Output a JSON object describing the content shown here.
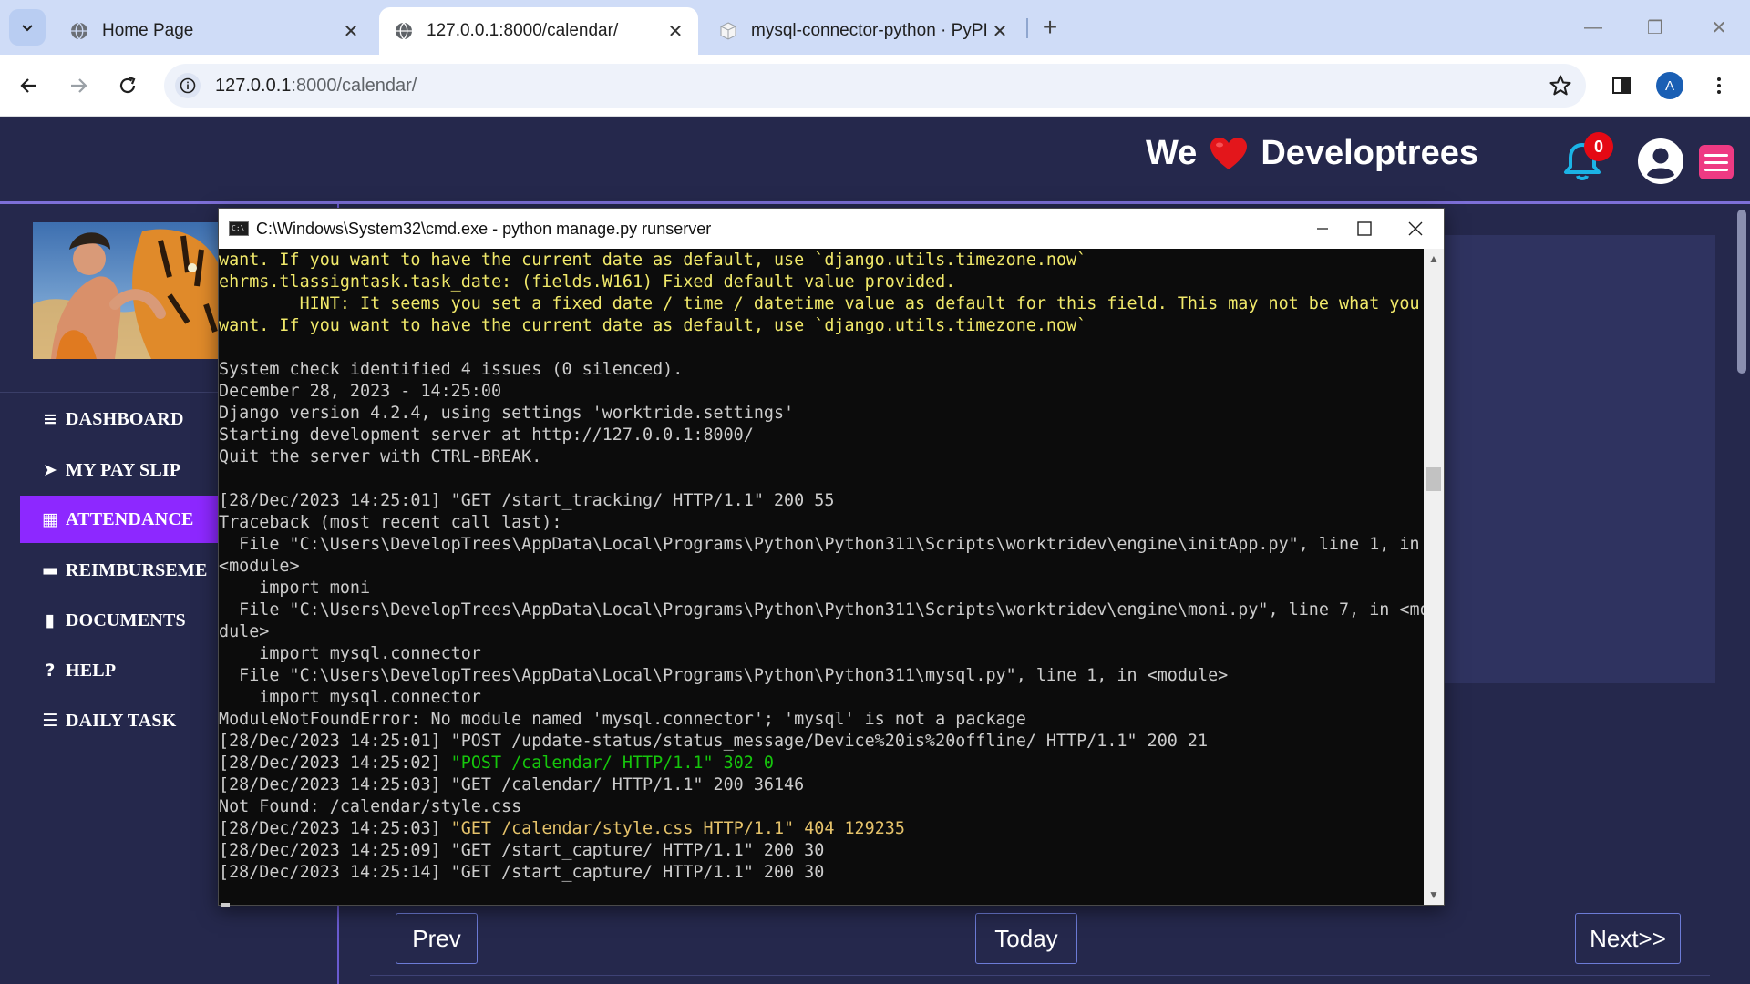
{
  "browser": {
    "tabs": [
      {
        "label": "Home Page",
        "active": false,
        "favicon": "globe-icon"
      },
      {
        "label": "127.0.0.1:8000/calendar/",
        "active": true,
        "favicon": "globe-icon"
      },
      {
        "label": "mysql-connector-python · PyPI",
        "active": false,
        "favicon": "pypi-cube-icon"
      }
    ],
    "address": {
      "host": "127.0.0.1",
      "path": ":8000/calendar/"
    },
    "profile_initial": "A"
  },
  "app": {
    "brand": {
      "prefix": "We",
      "heart": "❤",
      "name": "Developtrees"
    },
    "notifications_count": "0",
    "accent": "#8d28ff",
    "header_bg": "#25284c"
  },
  "sidebar": {
    "items": [
      {
        "label": "DASHBOARD",
        "icon": "≡",
        "icon_name": "bars-icon",
        "active": false
      },
      {
        "label": "MY PAY SLIP",
        "icon": "➤",
        "icon_name": "paper-plane-icon",
        "active": false
      },
      {
        "label": "ATTENDANCE",
        "icon": "▦",
        "icon_name": "calendar-icon",
        "active": true
      },
      {
        "label": "REIMBURSEME",
        "icon": "▬",
        "icon_name": "credit-card-icon",
        "active": false
      },
      {
        "label": "DOCUMENTS",
        "icon": "▮",
        "icon_name": "file-icon",
        "active": false
      },
      {
        "label": "HELP",
        "icon": "?",
        "icon_name": "question-circle-icon",
        "active": false
      },
      {
        "label": "DAILY TASK",
        "icon": "☰",
        "icon_name": "list-icon",
        "active": false
      }
    ]
  },
  "calendar": {
    "prev_label": "Prev",
    "today_label": "Today",
    "next_label": "Next>>"
  },
  "cmd": {
    "title": "C:\\Windows\\System32\\cmd.exe - python  manage.py runserver",
    "lines": [
      {
        "text": "want. If you want to have the current date as default, use `django.utils.timezone.now`",
        "color": "y"
      },
      {
        "text": "ehrms.tlassigntask.task_date: (fields.W161) Fixed default value provided.",
        "color": "y"
      },
      {
        "text": "        HINT: It seems you set a fixed date / time / datetime value as default for this field. This may not be what you",
        "color": "y"
      },
      {
        "text": "want. If you want to have the current date as default, use `django.utils.timezone.now`",
        "color": "y"
      },
      {
        "text": "",
        "color": ""
      },
      {
        "text": "System check identified 4 issues (0 silenced).",
        "color": ""
      },
      {
        "text": "December 28, 2023 - 14:25:00",
        "color": ""
      },
      {
        "text": "Django version 4.2.4, using settings 'worktride.settings'",
        "color": ""
      },
      {
        "text": "Starting development server at http://127.0.0.1:8000/",
        "color": ""
      },
      {
        "text": "Quit the server with CTRL-BREAK.",
        "color": ""
      },
      {
        "text": "",
        "color": ""
      },
      {
        "text": "[28/Dec/2023 14:25:01] \"GET /start_tracking/ HTTP/1.1\" 200 55",
        "color": ""
      },
      {
        "text": "Traceback (most recent call last):",
        "color": ""
      },
      {
        "text": "  File \"C:\\Users\\DevelopTrees\\AppData\\Local\\Programs\\Python\\Python311\\Scripts\\worktridev\\engine\\initApp.py\", line 1, in",
        "color": ""
      },
      {
        "text": "<module>",
        "color": ""
      },
      {
        "text": "    import moni",
        "color": ""
      },
      {
        "text": "  File \"C:\\Users\\DevelopTrees\\AppData\\Local\\Programs\\Python\\Python311\\Scripts\\worktridev\\engine\\moni.py\", line 7, in <mo",
        "color": ""
      },
      {
        "text": "dule>",
        "color": ""
      },
      {
        "text": "    import mysql.connector",
        "color": ""
      },
      {
        "text": "  File \"C:\\Users\\DevelopTrees\\AppData\\Local\\Programs\\Python\\Python311\\mysql.py\", line 1, in <module>",
        "color": ""
      },
      {
        "text": "    import mysql.connector",
        "color": ""
      },
      {
        "text": "ModuleNotFoundError: No module named 'mysql.connector'; 'mysql' is not a package",
        "color": ""
      },
      {
        "text": "[28/Dec/2023 14:25:01] \"POST /update-status/status_message/Device%20is%20offline/ HTTP/1.1\" 200 21",
        "color": ""
      },
      {
        "pre": "[28/Dec/2023 14:25:02] ",
        "text": "\"POST /calendar/ HTTP/1.1\" 302 0",
        "color": "g"
      },
      {
        "text": "[28/Dec/2023 14:25:03] \"GET /calendar/ HTTP/1.1\" 200 36146",
        "color": ""
      },
      {
        "text": "Not Found: /calendar/style.css",
        "color": ""
      },
      {
        "pre": "[28/Dec/2023 14:25:03] ",
        "text": "\"GET /calendar/style.css HTTP/1.1\" 404 129235",
        "color": "o"
      },
      {
        "text": "[28/Dec/2023 14:25:09] \"GET /start_capture/ HTTP/1.1\" 200 30",
        "color": ""
      },
      {
        "text": "[28/Dec/2023 14:25:14] \"GET /start_capture/ HTTP/1.1\" 200 30",
        "color": ""
      }
    ]
  }
}
